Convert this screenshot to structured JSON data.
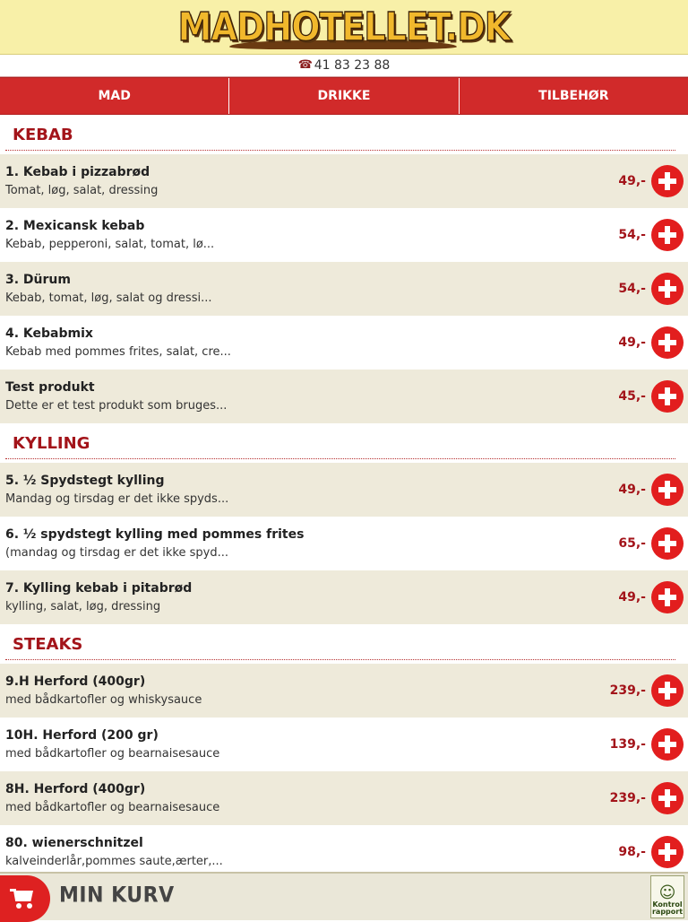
{
  "header": {
    "logo_text": "MADHOTELLET.DK"
  },
  "contact": {
    "phone": "41 83 23 88"
  },
  "nav": {
    "tabs": [
      "MAD",
      "DRIKKE",
      "TILBEHØR"
    ]
  },
  "sections": [
    {
      "title": "KEBAB",
      "items": [
        {
          "name": "1. Kebab i pizzabrød",
          "desc": "Tomat, løg, salat, dressing",
          "price": "49,-"
        },
        {
          "name": "2. Mexicansk kebab",
          "desc": "Kebab, pepperoni, salat, tomat, lø...",
          "price": "54,-"
        },
        {
          "name": "3. Dürum",
          "desc": "Kebab, tomat, løg, salat og dressi...",
          "price": "54,-"
        },
        {
          "name": "4. Kebabmix",
          "desc": "Kebab med pommes frites, salat, cre...",
          "price": "49,-"
        },
        {
          "name": "Test produkt",
          "desc": "Dette er et test produkt som bruges...",
          "price": "45,-"
        }
      ]
    },
    {
      "title": "KYLLING",
      "items": [
        {
          "name": "5. ½ Spydstegt kylling",
          "desc": "Mandag og tirsdag er det ikke spyds...",
          "price": "49,-"
        },
        {
          "name": "6. ½ spydstegt kylling med pommes frites",
          "desc": "(mandag og tirsdag er det ikke spyd...",
          "price": "65,-"
        },
        {
          "name": "7. Kylling kebab i pitabrød",
          "desc": "kylling, salat, løg, dressing",
          "price": "49,-"
        }
      ]
    },
    {
      "title": "STEAKS",
      "items": [
        {
          "name": "9.H Herford (400gr)",
          "desc": "med bådkartofler og whiskysauce",
          "price": "239,-"
        },
        {
          "name": "10H. Herford (200 gr)",
          "desc": "med bådkartofler og bearnaisesauce",
          "price": "139,-"
        },
        {
          "name": "8H. Herford (400gr)",
          "desc": "med bådkartofler og bearnaisesauce",
          "price": "239,-"
        },
        {
          "name": "80. wienerschnitzel",
          "desc": "kalveinderlår,pommes saute,ærter,...",
          "price": "98,-"
        }
      ]
    }
  ],
  "cart": {
    "label": "MIN KURV"
  },
  "badge": {
    "text": "Kontrol rapport"
  },
  "colors": {
    "accent": "#d12a2a",
    "header_bg": "#f8f0a8",
    "row_shade": "#eeeada",
    "title": "#a3141a"
  },
  "icons": {
    "phone": "phone-icon",
    "add": "plus-circle-icon",
    "cart": "shopping-cart-icon",
    "kontrol": "smiley-icon"
  }
}
